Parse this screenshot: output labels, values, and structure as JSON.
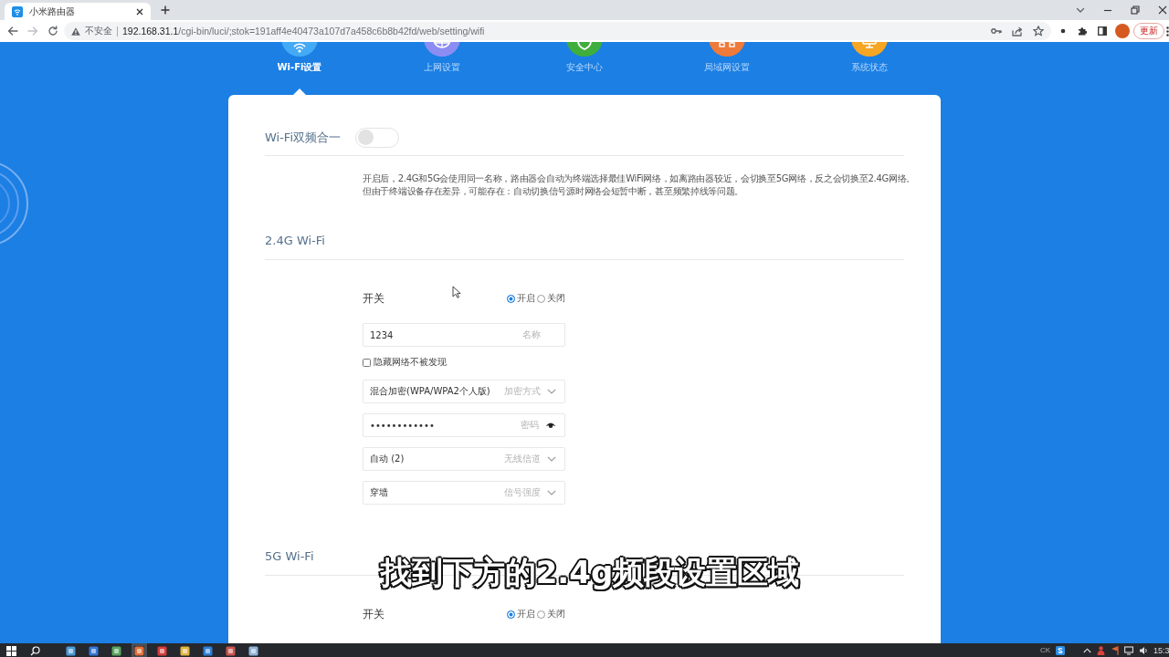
{
  "browser": {
    "tab": {
      "title": "小米路由器"
    },
    "forward_button": {
      "disabled": true
    },
    "address": {
      "security": "不安全",
      "host": "192.168.31.1",
      "path": "/cgi-bin/luci/;stok=191aff4e40473a107d7a458c6b8b42fd/web/setting/wifi"
    },
    "update_button": "更新"
  },
  "nav": [
    {
      "kind": "wifi",
      "label": "Wi-Fi设置",
      "selected": true,
      "color": "#45aaf5"
    },
    {
      "kind": "internet",
      "label": "上网设置",
      "selected": false,
      "color": "#8c8df2"
    },
    {
      "kind": "security",
      "label": "安全中心",
      "selected": false,
      "color": "#3fae3c"
    },
    {
      "kind": "lan",
      "label": "局域网设置",
      "selected": false,
      "color": "#ee7a3b"
    },
    {
      "kind": "status",
      "label": "系统状态",
      "selected": false,
      "color": "#f6a623"
    }
  ],
  "dual_band": {
    "label": "Wi-Fi双频合一",
    "on": false,
    "description": [
      "开启后，2.4G和5G会使用同一名称，路由器会自动为终端选择最佳WiFi网络，如离路由器较近，会切换至5G网络，反之会切换至2.4G网络。",
      "但由于终端设备存在差异，可能存在：自动切换信号源时网络会短暂中断，甚至频繁掉线等问题。"
    ]
  },
  "sections": [
    {
      "title": "2.4G Wi-Fi",
      "switch": {
        "label": "开关",
        "options": [
          {
            "label": "开启",
            "selected": true
          },
          {
            "label": "关闭",
            "selected": false
          }
        ]
      },
      "fields": [
        {
          "kind": "text",
          "value": "1234",
          "hint": "名称"
        },
        {
          "kind": "checkbox",
          "label": "隐藏网络不被发现",
          "checked": false
        },
        {
          "kind": "select",
          "value": "混合加密(WPA/WPA2个人版)",
          "hint": "加密方式"
        },
        {
          "kind": "password",
          "value": "••••••••••••",
          "hint": "密码"
        },
        {
          "kind": "select",
          "value": "自动 (2)",
          "hint": "无线信道"
        },
        {
          "kind": "select",
          "value": "穿墙",
          "hint": "信号强度"
        }
      ]
    },
    {
      "title": "5G Wi-Fi",
      "switch": {
        "label": "开关",
        "options": [
          {
            "label": "开启",
            "selected": true
          },
          {
            "label": "关闭",
            "selected": false
          }
        ]
      }
    }
  ],
  "caption": "找到下方的2.4g频段设置区域",
  "taskbar": {
    "input_indicator": "CK",
    "clock": "15:3"
  }
}
